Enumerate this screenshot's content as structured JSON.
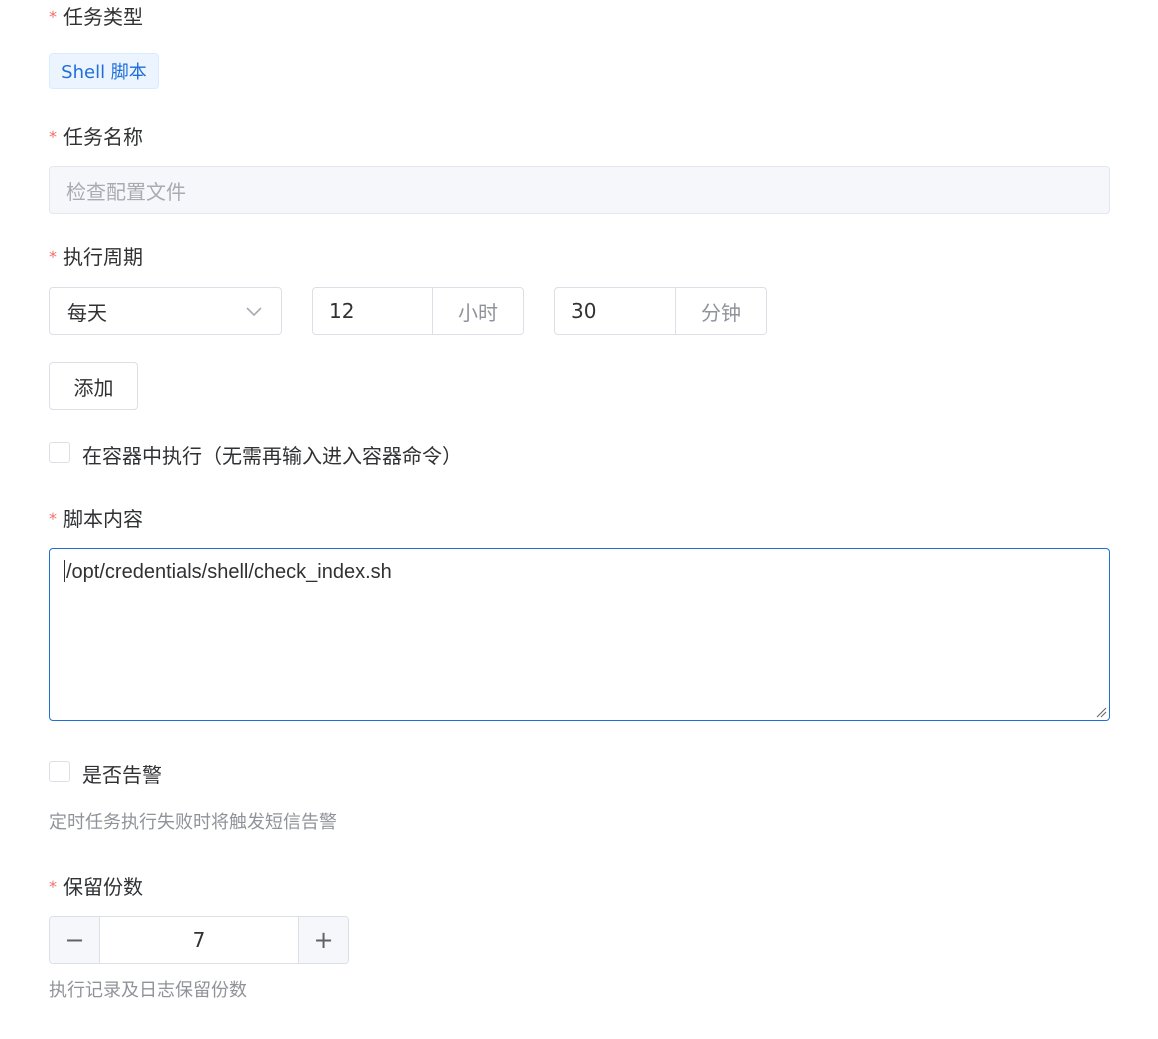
{
  "form": {
    "task_type": {
      "required_mark": "*",
      "label": "任务类型",
      "selected_tag": "Shell 脚本"
    },
    "task_name": {
      "required_mark": "*",
      "label": "任务名称",
      "placeholder": "检查配置文件"
    },
    "schedule": {
      "required_mark": "*",
      "label": "执行周期",
      "frequency": "每天",
      "hour_value": "12",
      "hour_unit": "小时",
      "minute_value": "30",
      "minute_unit": "分钟",
      "add_button": "添加"
    },
    "run_in_container": {
      "checked": false,
      "label": "在容器中执行（无需再输入进入容器命令）"
    },
    "script": {
      "required_mark": "*",
      "label": "脚本内容",
      "value": "/opt/credentials/shell/check_index.sh"
    },
    "alert": {
      "checked": false,
      "label": "是否告警",
      "hint": "定时任务执行失败时将触发短信告警"
    },
    "retention": {
      "required_mark": "*",
      "label": "保留份数",
      "value": "7",
      "minus": "−",
      "plus": "+",
      "hint": "执行记录及日志保留份数"
    }
  },
  "colors": {
    "accent": "#1f6fd8",
    "required": "#f56c6c",
    "border": "#dcdfe6",
    "muted_text": "#909399"
  }
}
